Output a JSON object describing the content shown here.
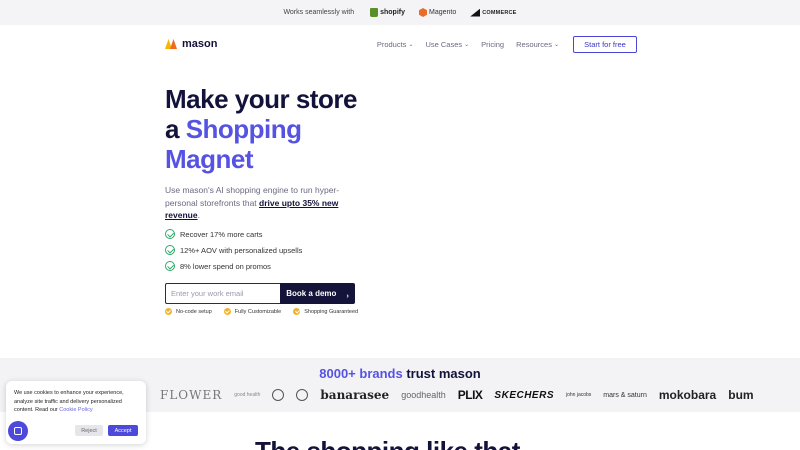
{
  "topbar": {
    "lead": "Works seamlessly with",
    "partners": [
      "shopify",
      "Magento",
      "COMMERCE"
    ]
  },
  "nav": {
    "logo": "mason",
    "items": [
      "Products",
      "Use Cases",
      "Pricing",
      "Resources"
    ],
    "cta": "Start for free"
  },
  "hero": {
    "title_line1": "Make your store",
    "title_line2_prefix": "a ",
    "title_line2_accent": "Shopping",
    "title_line3_accent": "Magnet",
    "subtitle_pre": "Use mason's AI shopping engine to run hyper-personal storefronts that ",
    "subtitle_highlight": "drive upto 35% new revenue",
    "subtitle_post": ".",
    "benefits": [
      "Recover 17% more carts",
      "12%+ AOV with personalized upsells",
      "8% lower spend on promos"
    ],
    "email_placeholder": "Enter your work email",
    "demo_button": "Book a demo",
    "features": [
      "No-code setup",
      "Fully Customizable",
      "Shopping Guaranteed"
    ]
  },
  "brands": {
    "title_accent": "8000+ brands",
    "title_rest": " trust mason",
    "logos": [
      "FLOWER",
      "good health",
      "banarasee",
      "goodhealth",
      "PLIX",
      "SKECHERS",
      "john jacobs",
      "mars & saturn",
      "mokobara",
      "bum"
    ]
  },
  "bottom_heading": "The shopping like that",
  "cookie": {
    "text": "We use cookies to enhance your experience, analyze site traffic and delivery personalized content. Read our ",
    "link": "Cookie Policy",
    "reject": "Reject",
    "accept": "Accept"
  },
  "colors": {
    "accent": "#5653e3",
    "navy": "#13123a",
    "check_green": "#2fa96d",
    "badge_yellow": "#f1b22a"
  }
}
